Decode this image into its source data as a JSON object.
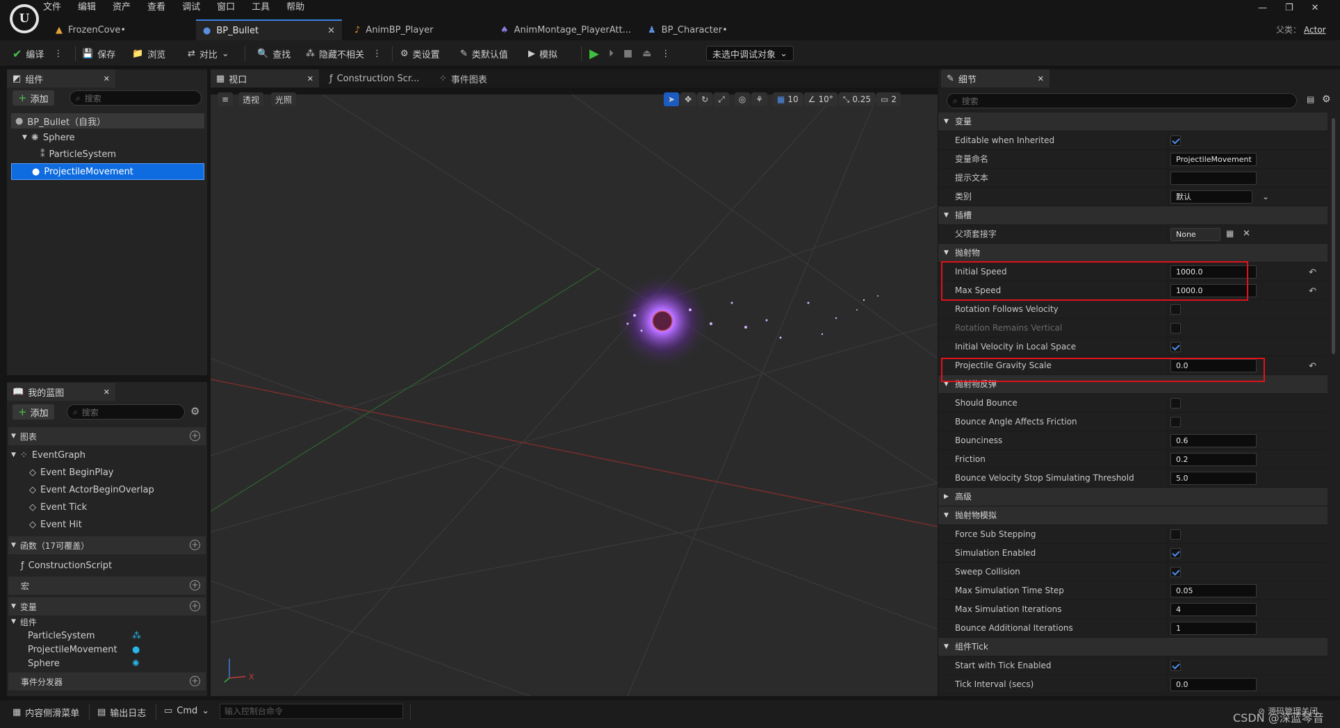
{
  "menu": [
    "文件",
    "编辑",
    "资产",
    "查看",
    "调试",
    "窗口",
    "工具",
    "帮助"
  ],
  "doc_tabs": [
    {
      "label": "FrozenCove•",
      "active": false
    },
    {
      "label": "BP_Bullet",
      "active": true
    },
    {
      "label": "AnimBP_Player",
      "active": false
    },
    {
      "label": "AnimMontage_PlayerAtt...",
      "active": false
    },
    {
      "label": "BP_Character•",
      "active": false
    }
  ],
  "parent": {
    "label": "父类：",
    "value": "Actor"
  },
  "toolbar": {
    "compile": "编译",
    "save": "保存",
    "browse": "浏览",
    "diff": "对比",
    "find": "查找",
    "hide": "隐藏不相关",
    "class_settings": "类设置",
    "class_defaults": "类默认值",
    "simulate": "模拟",
    "debug_target": "未选中调试对象"
  },
  "components": {
    "tab": "组件",
    "add": "添加",
    "search_placeholder": "搜索",
    "root": "BP_Bullet（自我）",
    "sphere": "Sphere",
    "particle": "ParticleSystem",
    "projectile": "ProjectileMovement"
  },
  "mybp": {
    "tab": "我的蓝图",
    "add": "添加",
    "search_placeholder": "搜索",
    "graphs": "图表",
    "eventgraph": "EventGraph",
    "events": [
      "Event BeginPlay",
      "Event ActorBeginOverlap",
      "Event Tick",
      "Event Hit"
    ],
    "functions": "函数（17可覆盖）",
    "construction": "ConstructionScript",
    "macros": "宏",
    "variables": "变量",
    "var_group": "组件",
    "vars": [
      "ParticleSystem",
      "ProjectileMovement",
      "Sphere"
    ],
    "dispatchers": "事件分发器"
  },
  "center_tabs": {
    "viewport": "视口",
    "construction": "Construction Scr...",
    "eventgraph": "事件图表"
  },
  "viewport": {
    "perspective": "透视",
    "lit": "光照",
    "grid": "10",
    "angle": "10°",
    "scale": "0.25",
    "cam": "2",
    "axis_x": "X"
  },
  "details": {
    "tab": "细节",
    "search_placeholder": "搜索",
    "rows": [
      {
        "t": "cat",
        "label": "变量"
      },
      {
        "t": "chk",
        "label": "Editable when Inherited",
        "on": true
      },
      {
        "t": "val",
        "label": "变量命名",
        "value": "ProjectileMovement"
      },
      {
        "t": "val",
        "label": "提示文本",
        "value": ""
      },
      {
        "t": "combo",
        "label": "类别",
        "value": "默认"
      },
      {
        "t": "cat",
        "label": "插槽"
      },
      {
        "t": "socket",
        "label": "父项套接字",
        "value": "None"
      },
      {
        "t": "cat",
        "label": "抛射物"
      },
      {
        "t": "val",
        "label": "Initial Speed",
        "value": "1000.0",
        "reset": true
      },
      {
        "t": "val",
        "label": "Max Speed",
        "value": "1000.0",
        "reset": true
      },
      {
        "t": "chk",
        "label": "Rotation Follows Velocity",
        "on": false
      },
      {
        "t": "chk",
        "label": "Rotation Remains Vertical",
        "on": false,
        "dis": true
      },
      {
        "t": "chk",
        "label": "Initial Velocity in Local Space",
        "on": true
      },
      {
        "t": "val",
        "label": "Projectile Gravity Scale",
        "value": "0.0",
        "reset": true
      },
      {
        "t": "cat",
        "label": "抛射物反弹"
      },
      {
        "t": "chk",
        "label": "Should Bounce",
        "on": false
      },
      {
        "t": "chk",
        "label": "Bounce Angle Affects Friction",
        "on": false
      },
      {
        "t": "val",
        "label": "Bounciness",
        "value": "0.6"
      },
      {
        "t": "val",
        "label": "Friction",
        "value": "0.2"
      },
      {
        "t": "val",
        "label": "Bounce Velocity Stop Simulating Threshold",
        "value": "5.0"
      },
      {
        "t": "catc",
        "label": "高级"
      },
      {
        "t": "cat",
        "label": "抛射物模拟"
      },
      {
        "t": "chk",
        "label": "Force Sub Stepping",
        "on": false
      },
      {
        "t": "chk",
        "label": "Simulation Enabled",
        "on": true
      },
      {
        "t": "chk",
        "label": "Sweep Collision",
        "on": true
      },
      {
        "t": "val",
        "label": "Max Simulation Time Step",
        "value": "0.05"
      },
      {
        "t": "val",
        "label": "Max Simulation Iterations",
        "value": "4"
      },
      {
        "t": "val",
        "label": "Bounce Additional Iterations",
        "value": "1"
      },
      {
        "t": "cat",
        "label": "组件Tick"
      },
      {
        "t": "chk",
        "label": "Start with Tick Enabled",
        "on": true
      },
      {
        "t": "val",
        "label": "Tick Interval (secs)",
        "value": "0.0"
      }
    ]
  },
  "bottom": {
    "drawer": "内容侧滑菜单",
    "log": "输出日志",
    "cmd": "Cmd",
    "console_placeholder": "输入控制台命令",
    "watermark": "CSDN @深蓝琴音",
    "status": "源码管理关闭"
  },
  "colors": {
    "accent": "#3a83e6",
    "highlight": "#0e6ce0",
    "red": "#e0121b",
    "particle": "#b46cff"
  }
}
